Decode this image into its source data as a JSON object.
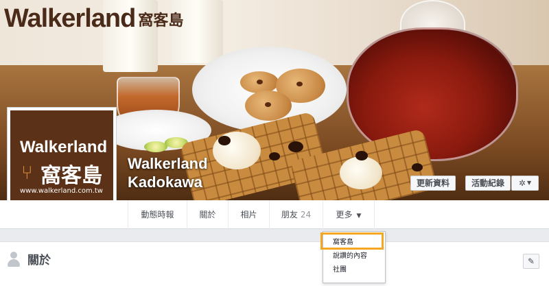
{
  "brand": {
    "name_latin": "Walkerland",
    "name_chinese": "窩客島"
  },
  "profile": {
    "logo_text": "Walkerland",
    "logo_chinese": "窩客島",
    "logo_url": "www.walkerland.com.tw"
  },
  "page": {
    "name_line1": "Walkerland",
    "name_line2": "Kadokawa"
  },
  "cover_buttons": {
    "update_info": "更新資料",
    "activity_log": "活動紀錄",
    "settings_icon": "gear-icon"
  },
  "tabs": [
    {
      "label": "動態時報"
    },
    {
      "label": "關於"
    },
    {
      "label": "相片"
    },
    {
      "label": "朋友",
      "count": "24"
    },
    {
      "label": "更多"
    }
  ],
  "more_menu": {
    "items": [
      "窩客島",
      "說讚的內容",
      "社團"
    ],
    "highlighted": "窩客島",
    "highlight_color": "#f5a623"
  },
  "about": {
    "title": "關於"
  },
  "colors": {
    "brand_brown": "#5b3117",
    "accent_orange": "#f5a623",
    "nav_text": "#4b4f56"
  }
}
